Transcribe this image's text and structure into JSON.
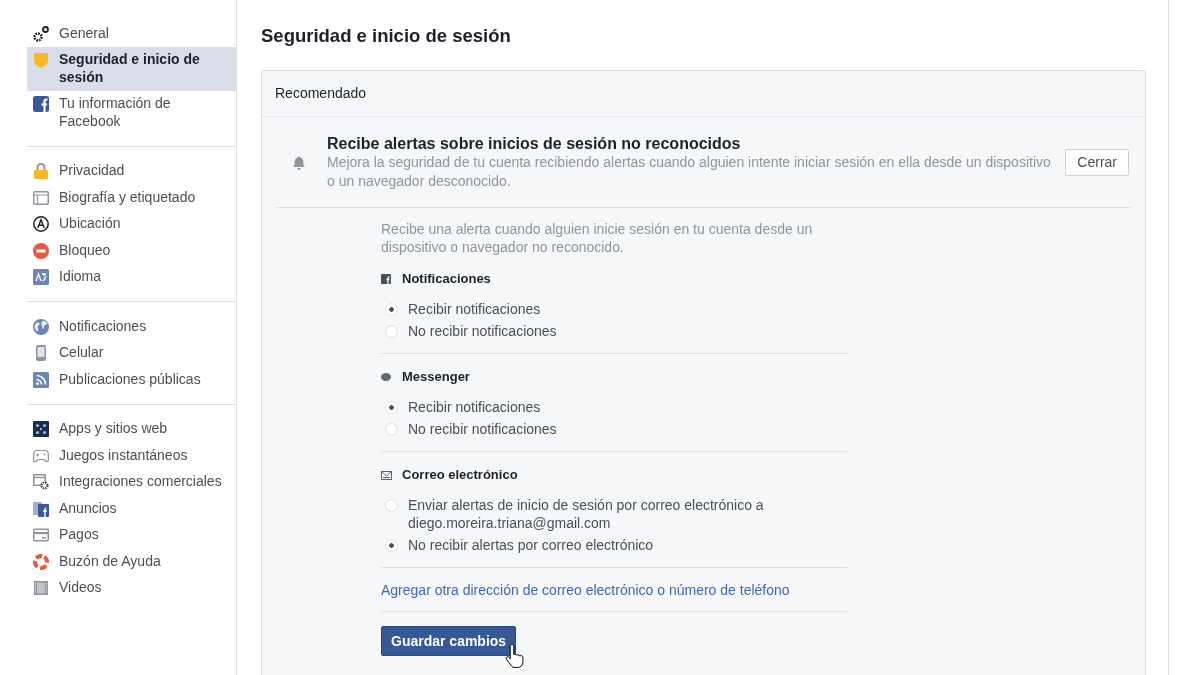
{
  "sidebar": {
    "groups": [
      {
        "items": [
          {
            "label": "General",
            "selected": false
          },
          {
            "label": "Seguridad e inicio de sesión",
            "selected": true
          },
          {
            "label": "Tu información de Facebook",
            "selected": false
          }
        ]
      },
      {
        "items": [
          {
            "label": "Privacidad",
            "selected": false
          },
          {
            "label": "Biografía y etiquetado",
            "selected": false
          },
          {
            "label": "Ubicación",
            "selected": false
          },
          {
            "label": "Bloqueo",
            "selected": false
          },
          {
            "label": "Idioma",
            "selected": false
          }
        ]
      },
      {
        "items": [
          {
            "label": "Notificaciones",
            "selected": false
          },
          {
            "label": "Celular",
            "selected": false
          },
          {
            "label": "Publicaciones públicas",
            "selected": false
          }
        ]
      },
      {
        "items": [
          {
            "label": "Apps y sitios web",
            "selected": false
          },
          {
            "label": "Juegos instantáneos",
            "selected": false
          },
          {
            "label": "Integraciones comerciales",
            "selected": false
          },
          {
            "label": "Anuncios",
            "selected": false
          },
          {
            "label": "Pagos",
            "selected": false
          },
          {
            "label": "Buzón de Ayuda",
            "selected": false
          },
          {
            "label": "Videos",
            "selected": false
          }
        ]
      }
    ]
  },
  "page_title": "Seguridad e inicio de sesión",
  "panel": {
    "header": "Recomendado",
    "alert": {
      "title": "Recibe alertas sobre inicios de sesión no reconocidos",
      "description": "Mejora la seguridad de tu cuenta recibiendo alertas cuando alguien intente iniciar sesión en ella desde un dispositivo o un navegador desconocido.",
      "close_button": "Cerrar"
    },
    "intro": "Recibe una alerta cuando alguien inicie sesión en tu cuenta desde un dispositivo o navegador no reconocido.",
    "sections": [
      {
        "title": "Notificaciones",
        "options": [
          {
            "label": "Recibir notificaciones",
            "selected": true
          },
          {
            "label": "No recibir notificaciones",
            "selected": false
          }
        ]
      },
      {
        "title": "Messenger",
        "options": [
          {
            "label": "Recibir notificaciones",
            "selected": true
          },
          {
            "label": "No recibir notificaciones",
            "selected": false
          }
        ]
      },
      {
        "title": "Correo electrónico",
        "options": [
          {
            "label": "Enviar alertas de inicio de sesión por correo electrónico a diego.moreira.triana@gmail.com",
            "selected": false
          },
          {
            "label": "No recibir alertas por correo electrónico",
            "selected": true
          }
        ]
      }
    ],
    "add_link": "Agregar otra dirección de correo electrónico o número de teléfono",
    "save_button": "Guardar cambios"
  }
}
